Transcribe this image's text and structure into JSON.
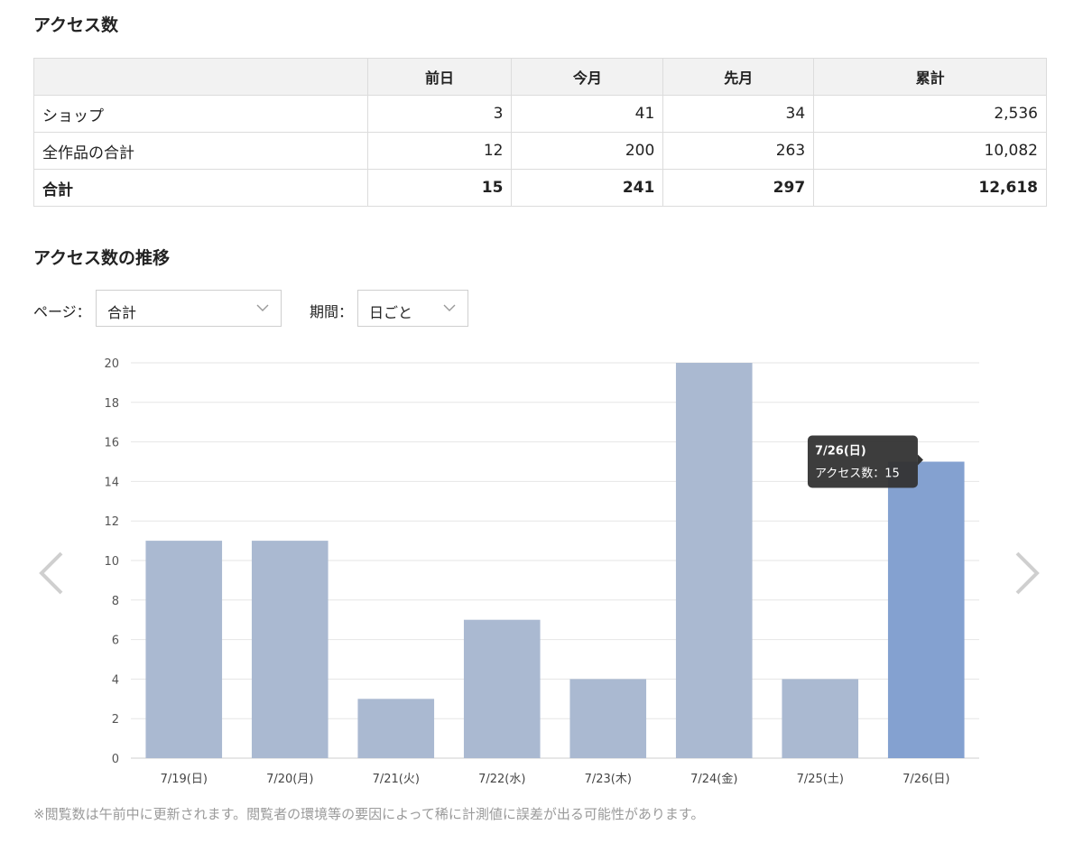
{
  "access_section": {
    "title": "アクセス数",
    "table": {
      "headers": [
        "",
        "前日",
        "今月",
        "先月",
        "累計"
      ],
      "rows": [
        {
          "label": "ショップ",
          "values": [
            "3",
            "41",
            "34",
            "2,536"
          ]
        },
        {
          "label": "全作品の合計",
          "values": [
            "12",
            "200",
            "263",
            "10,082"
          ]
        }
      ],
      "total": {
        "label": "合計",
        "values": [
          "15",
          "241",
          "297",
          "12,618"
        ]
      }
    }
  },
  "trend_section": {
    "title": "アクセス数の推移",
    "page_filter": {
      "label": "ページ：",
      "value": "合計"
    },
    "period_filter": {
      "label": "期間：",
      "value": "日ごと"
    }
  },
  "chart_data": {
    "type": "bar",
    "categories": [
      "7/19(日)",
      "7/20(月)",
      "7/21(火)",
      "7/22(水)",
      "7/23(木)",
      "7/24(金)",
      "7/25(土)",
      "7/26(日)"
    ],
    "values": [
      11,
      11,
      3,
      7,
      4,
      20,
      4,
      15
    ],
    "ylim": [
      0,
      20
    ],
    "yticks": [
      0,
      2,
      4,
      6,
      8,
      10,
      12,
      14,
      16,
      18,
      20
    ],
    "grid": true,
    "colors": {
      "bar": "#aab9d1",
      "highlight": "#84a1d0",
      "tooltip_bg": "#333333"
    },
    "highlight_index": 7,
    "tooltip": {
      "title": "7/26(日)",
      "series_label": "アクセス数",
      "value": "15"
    }
  },
  "icons": {
    "prev": "chevron-left-icon",
    "next": "chevron-right-icon",
    "dropdown": "chevron-down-icon"
  },
  "footnote": "※閲覧数は午前中に更新されます。閲覧者の環境等の要因によって稀に計測値に誤差が出る可能性があります。"
}
